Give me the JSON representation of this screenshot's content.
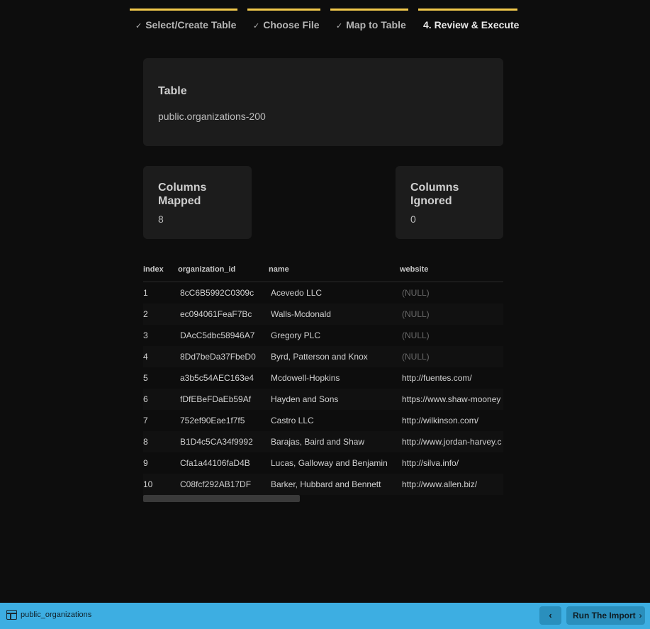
{
  "stepper": {
    "steps": [
      {
        "label": "Select/Create Table",
        "done": true
      },
      {
        "label": "Choose File",
        "done": true
      },
      {
        "label": "Map to Table",
        "done": true
      },
      {
        "label": "4. Review & Execute",
        "done": false
      }
    ],
    "check_glyph": "✓",
    "accent_color": "#f2c94c"
  },
  "table_card": {
    "title": "Table",
    "value": "public.organizations-200"
  },
  "stats": {
    "mapped": {
      "title": "Columns Mapped",
      "value": "8"
    },
    "ignored": {
      "title": "Columns Ignored",
      "value": "0"
    }
  },
  "grid": {
    "columns": [
      "index",
      "organization_id",
      "name",
      "website"
    ],
    "rows": [
      [
        "1",
        "8cC6B5992C0309c",
        "Acevedo LLC",
        "(NULL)"
      ],
      [
        "2",
        "ec094061FeaF7Bc",
        "Walls-Mcdonald",
        "(NULL)"
      ],
      [
        "3",
        "DAcC5dbc58946A7",
        "Gregory PLC",
        "(NULL)"
      ],
      [
        "4",
        "8Dd7beDa37FbeD0",
        "Byrd, Patterson and Knox",
        "(NULL)"
      ],
      [
        "5",
        "a3b5c54AEC163e4",
        "Mcdowell-Hopkins",
        "http://fuentes.com/"
      ],
      [
        "6",
        "fDfEBeFDaEb59Af",
        "Hayden and Sons",
        "https://www.shaw-mooney"
      ],
      [
        "7",
        "752ef90Eae1f7f5",
        "Castro LLC",
        "http://wilkinson.com/"
      ],
      [
        "8",
        "B1D4c5CA34f9992",
        "Barajas, Baird and Shaw",
        "http://www.jordan-harvey.c"
      ],
      [
        "9",
        "Cfa1a44106faD4B",
        "Lucas, Galloway and Benjamin",
        "http://silva.info/"
      ],
      [
        "10",
        "C08fcf292AB17DF",
        "Barker, Hubbard and Bennett",
        "http://www.allen.biz/"
      ]
    ]
  },
  "footer": {
    "icon": "table-icon",
    "name": "public_organizations",
    "back_glyph": "‹",
    "run_label": "Run The Import",
    "run_glyph": "›",
    "bar_color": "#3daee2"
  }
}
